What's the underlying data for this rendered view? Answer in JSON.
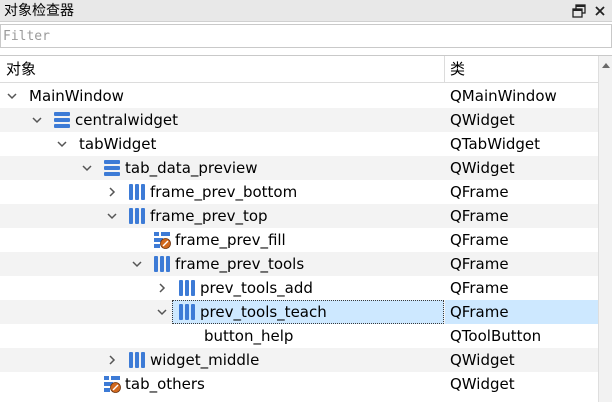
{
  "panel": {
    "title": "对象检查器"
  },
  "filter": {
    "placeholder": "Filter"
  },
  "header": {
    "object_col": "对象",
    "class_col": "类"
  },
  "rows": [
    {
      "name": "MainWindow",
      "class": "QMainWindow",
      "expand": "expanded",
      "icon": "none"
    },
    {
      "name": "centralwidget",
      "class": "QWidget",
      "expand": "expanded",
      "icon": "vertical-layout-icon"
    },
    {
      "name": "tabWidget",
      "class": "QTabWidget",
      "expand": "expanded",
      "icon": "none"
    },
    {
      "name": "tab_data_preview",
      "class": "QWidget",
      "expand": "expanded",
      "icon": "vertical-layout-icon"
    },
    {
      "name": "frame_prev_bottom",
      "class": "QFrame",
      "expand": "collapsed",
      "icon": "horizontal-layout-icon"
    },
    {
      "name": "frame_prev_top",
      "class": "QFrame",
      "expand": "expanded",
      "icon": "horizontal-layout-icon"
    },
    {
      "name": "frame_prev_fill",
      "class": "QFrame",
      "expand": "none",
      "icon": "broken-layout-icon"
    },
    {
      "name": "frame_prev_tools",
      "class": "QFrame",
      "expand": "expanded",
      "icon": "horizontal-layout-icon"
    },
    {
      "name": "prev_tools_add",
      "class": "QFrame",
      "expand": "collapsed",
      "icon": "horizontal-layout-icon"
    },
    {
      "name": "prev_tools_teach",
      "class": "QFrame",
      "expand": "expanded",
      "icon": "horizontal-layout-icon",
      "selected": true
    },
    {
      "name": "button_help",
      "class": "QToolButton",
      "expand": "none",
      "icon": "none"
    },
    {
      "name": "widget_middle",
      "class": "QWidget",
      "expand": "collapsed",
      "icon": "horizontal-layout-icon"
    },
    {
      "name": "tab_others",
      "class": "QWidget",
      "expand": "none",
      "icon": "broken-layout-icon"
    }
  ],
  "colors": {
    "selection": "#cde8ff",
    "alternate_row": "#f3f3f3",
    "layout_icon": "#3d7bd6"
  }
}
